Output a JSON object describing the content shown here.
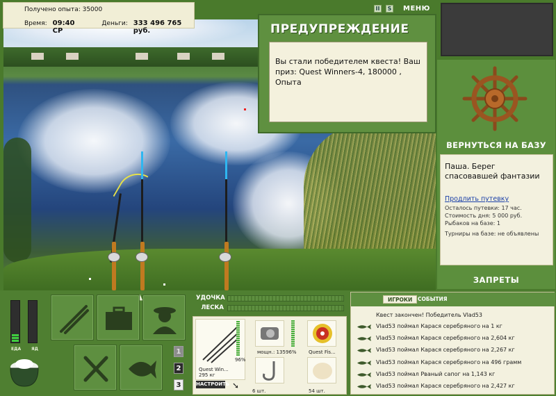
{
  "info": {
    "xp_line": "Получено опыта: 35000",
    "time_label": "Время:",
    "time_value": "09:40 СР",
    "money_label": "Деньги:",
    "money_value": "333 496 765 руб."
  },
  "top_controls": {
    "btn_pause": "II",
    "btn_s": "S",
    "menu": "МЕНЮ"
  },
  "warning": {
    "title": "ПРЕДУПРЕЖДЕНИЕ",
    "message": "Вы стали победителем квеста! Ваш приз: Quest Winners-4, 180000 , Опыта"
  },
  "right": {
    "back_to_base": "ВЕРНУТЬСЯ НА БАЗУ",
    "base_name": "Паша. Берег спасовавшей фантазии",
    "extend_link": "Продлить путевку",
    "lines": [
      "Осталось путевки: 17 час.",
      "Стоимость дня: 5 000 руб.",
      "Рыбаков на базе: 1",
      "Турниры на базе: не объявлены"
    ],
    "bans": "ЗАПРЕТЫ"
  },
  "meters": {
    "food_label": "ЕДА",
    "poison_label": "ЯД",
    "food_level": 0.18,
    "poison_level": 0.0
  },
  "nav_numbers": [
    "1",
    "2",
    "3"
  ],
  "bars": {
    "rod_label": "УДОЧКА",
    "line_label": "ЛЕСКА"
  },
  "equipment": {
    "rod_percent": "96%",
    "rod_name": "Quest Win...",
    "rod_weight": "295 кг",
    "reel_power": "мощн.: 135",
    "reel_percent": "96%",
    "line_name": "Quest Fis...",
    "hook_count": "6 шт.",
    "bait_count": "54 шт.",
    "setup_button": "НАСТРОИТЬ"
  },
  "events": {
    "tab_players": "ИГРОКИ",
    "tab_events": "СОБЫТИЯ",
    "header": "Квест закончен! Победитель Vlad53",
    "rows": [
      "Vlad53 поймал Карася серебряного на 1 кг",
      "Vlad53 поймал Карася серебряного на 2,604 кг",
      "Vlad53 поймал Карася серебряного на 2,267 кг",
      "Vlad53 поймал Карася серебряного на 496 грамм",
      "Vlad53 поймал Рваный сапог на 1,143 кг",
      "Vlad53 поймал Карася серебряного на 2,427 кг"
    ]
  }
}
